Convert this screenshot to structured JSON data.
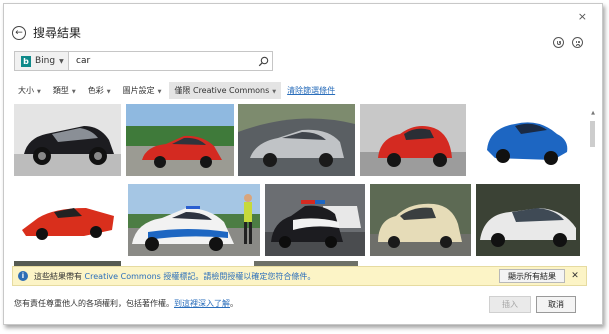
{
  "dialog": {
    "title": "搜尋結果",
    "close_glyph": "×",
    "back_glyph": "←"
  },
  "search": {
    "engine": "Bing",
    "query": "car",
    "placeholder": ""
  },
  "filters": {
    "items": [
      {
        "label": "大小"
      },
      {
        "label": "類型"
      },
      {
        "label": "色彩"
      },
      {
        "label": "圖片設定"
      },
      {
        "label": "僅限 Creative Commons"
      }
    ],
    "clear_label": "清除篩選條件"
  },
  "results": {
    "colors": {
      "red": "#d42a21",
      "blue": "#1d66c2",
      "silver": "#c0c3c6",
      "black": "#1c1c20",
      "white": "#f2f2f2",
      "cream": "#e6dcb8"
    }
  },
  "infobar": {
    "text_before": "這些結果帶有 ",
    "cc": "Creative Commons",
    "text_middle": " 授權標記。請檢閱授權以確定您符合條件。",
    "show_all": "顯示所有結果",
    "close_glyph": "✕"
  },
  "footer": {
    "text": "您有責任尊重他人的各項權利，包括著作權。",
    "link": "到這裡深入了解",
    "link_end": "。",
    "insert": "插入",
    "cancel": "取消"
  },
  "colors": {
    "accent": "#2a6ebb",
    "info_bg": "#fcf4c6",
    "bing": "#0f8a8a"
  }
}
